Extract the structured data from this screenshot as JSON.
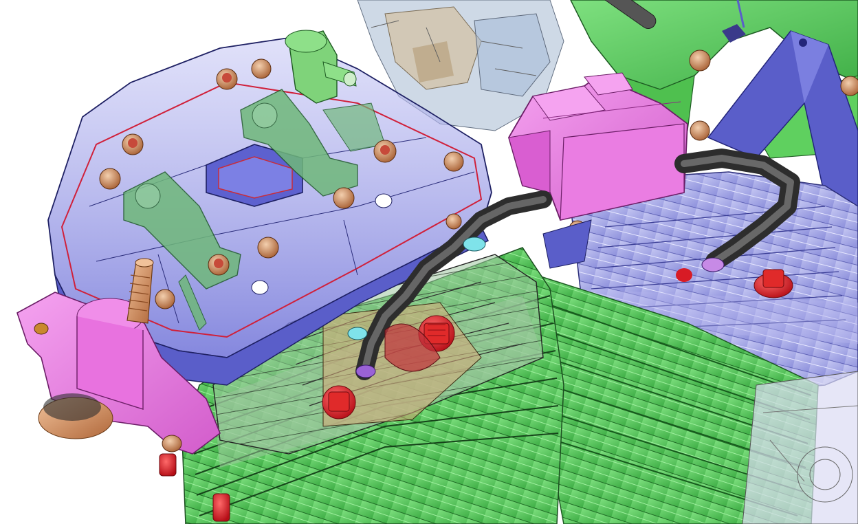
{
  "viewport": {
    "background": "#ffffff",
    "render_style": "shaded-with-edges, semi-transparent",
    "part_colors": {
      "rocker_cover": "#6f72d8",
      "rocker_cover_glass": "#8c8fe6",
      "cylinder_green": "#56c85a",
      "bracket_magenta": "#e06ad6",
      "coil_box_pink": "#ef7fe8",
      "frame_blue": "#5a5ec9",
      "head_lavender": "#a8abea",
      "bolt_copper": "#c98655",
      "spark_plug_red": "#d81b25",
      "hose_dark_gray": "#4b4b4b",
      "connector_green": "#7fd37a",
      "background_assembly_tan": "#b89a6a",
      "background_assembly_blue": "#5c7fa8"
    }
  }
}
